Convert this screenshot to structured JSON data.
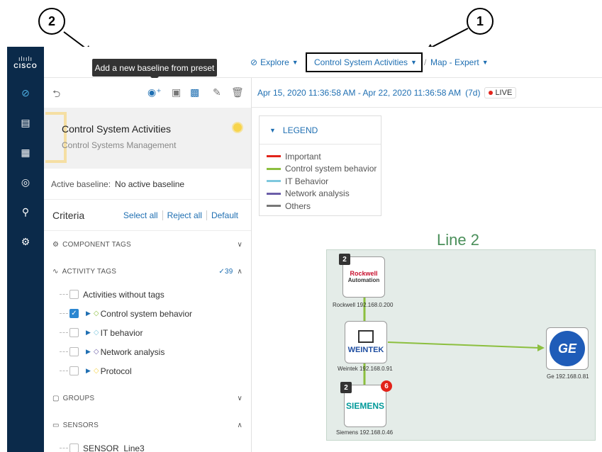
{
  "callouts": {
    "one": "1",
    "two": "2"
  },
  "tooltip": "Add a new baseline from preset",
  "brand": {
    "bars": "ılıılı",
    "name": "CISCO"
  },
  "nav": {
    "explore": "Explore",
    "current": "Control System Activities",
    "separator": "/",
    "map": "Map - Expert"
  },
  "preset": {
    "title": "Control System Activities",
    "subtitle": "Control Systems Management"
  },
  "baseline": {
    "label": "Active baseline:",
    "value": "No active baseline"
  },
  "criteria": {
    "title": "Criteria",
    "select_all": "Select all",
    "reject_all": "Reject all",
    "default": "Default"
  },
  "sections": {
    "component_tags": "COMPONENT TAGS",
    "activity_tags": "ACTIVITY TAGS",
    "activity_count": "✓39",
    "groups": "GROUPS",
    "sensors": "SENSORS"
  },
  "activity_items": [
    {
      "label": "Activities without tags",
      "checked": false
    },
    {
      "label": "Control system behavior",
      "checked": true
    },
    {
      "label": "IT behavior",
      "checked": false
    },
    {
      "label": "Network analysis",
      "checked": false
    },
    {
      "label": "Protocol",
      "checked": false
    }
  ],
  "sensor_items": [
    {
      "label": "SENSOR_Line3"
    }
  ],
  "daterange": "Apr 15, 2020 11:36:58 AM - Apr 22, 2020 11:36:58 AM",
  "duration": "(7d)",
  "live": "LIVE",
  "legend": {
    "title": "LEGEND",
    "items": [
      {
        "label": "Important",
        "color": "#e2231a"
      },
      {
        "label": "Control system behavior",
        "color": "#8cbf3f"
      },
      {
        "label": "IT Behavior",
        "color": "#7ec8de"
      },
      {
        "label": "Network analysis",
        "color": "#6b5ea8"
      },
      {
        "label": "Others",
        "color": "#777777"
      }
    ]
  },
  "zone": {
    "title": "Line 2"
  },
  "nodes": {
    "rockwell": {
      "logo_top": "Rockwell",
      "logo_bottom": "Automation",
      "label": "Rockwell 192.168.0.200",
      "badge": "2"
    },
    "weintek": {
      "logo": "WEINTEK",
      "label": "Weintek 192.168.0.91"
    },
    "siemens": {
      "logo": "SIEMENS",
      "label": "Siemens 192.168.0.46",
      "badge": "2",
      "alert": "6"
    },
    "ge": {
      "logo": "GE",
      "label": "Ge 192.168.0.81"
    }
  },
  "colors": {
    "accent": "#1f6fb2",
    "rail": "#0b2a4a",
    "flow": "#8cbf3f"
  }
}
